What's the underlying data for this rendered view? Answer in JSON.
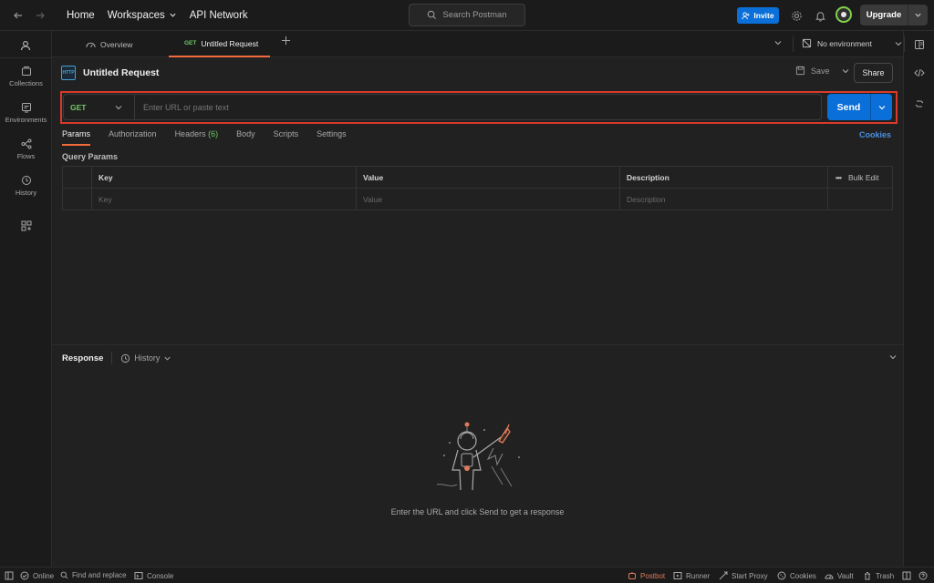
{
  "header": {
    "nav_links": [
      "Home",
      "Workspaces",
      "API Network"
    ],
    "search_placeholder": "Search Postman",
    "invite_label": "Invite",
    "upgrade_label": "Upgrade"
  },
  "sidebar": {
    "items": [
      {
        "label": "Collections",
        "icon": "collections-icon"
      },
      {
        "label": "Environments",
        "icon": "environments-icon"
      },
      {
        "label": "Flows",
        "icon": "flows-icon"
      },
      {
        "label": "History",
        "icon": "history-icon"
      }
    ]
  },
  "tabs": {
    "items": [
      {
        "label": "Overview"
      },
      {
        "method": "GET",
        "label": "Untitled Request",
        "active": true
      }
    ],
    "environment": "No environment"
  },
  "request": {
    "title": "Untitled Request",
    "save_label": "Save",
    "share_label": "Share",
    "method": "GET",
    "url_placeholder": "Enter URL or paste text",
    "send_label": "Send",
    "subtabs": [
      "Params",
      "Authorization",
      "Headers",
      "Body",
      "Scripts",
      "Settings"
    ],
    "headers_count": "(6)",
    "cookies_label": "Cookies",
    "query_params_label": "Query Params",
    "table": {
      "columns": [
        "Key",
        "Value",
        "Description"
      ],
      "bulk_edit": "Bulk Edit",
      "placeholders": [
        "Key",
        "Value",
        "Description"
      ]
    }
  },
  "response": {
    "title": "Response",
    "history_label": "History",
    "empty_message": "Enter the URL and click Send to get a response"
  },
  "status_bar": {
    "left": [
      "Online",
      "Find and replace",
      "Console"
    ],
    "right": [
      "Postbot",
      "Runner",
      "Start Proxy",
      "Cookies",
      "Vault",
      "Trash"
    ]
  },
  "colors": {
    "accent_orange": "#f26b3a",
    "send_blue": "#0a6fd8",
    "get_green": "#6fca66",
    "highlight_red": "#d93a2b"
  }
}
